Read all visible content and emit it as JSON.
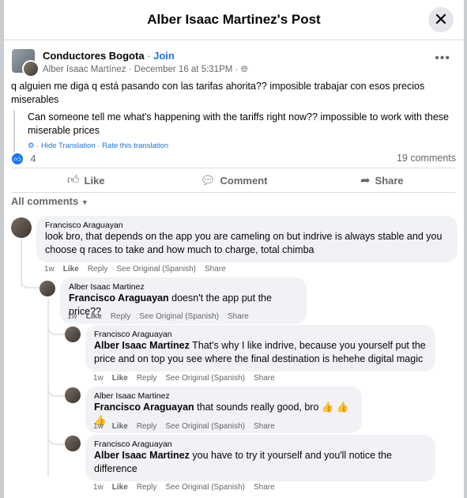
{
  "header": {
    "title": "Alber Isaac Martinez's Post"
  },
  "post": {
    "group": "Conductores Bogota",
    "join": "Join",
    "author_line": "Alber Isaac Martínez · December 16 at 5:31PM ·",
    "text": "q alguien me diga q está pasando con las tarifas ahorita?? imposible trabajar con esos precios miserables",
    "translation": "Can someone tell me what's happening with the tariffs right now?? impossible to work with these miserable prices",
    "hide_translation": "Hide Translation",
    "rate_translation": "Rate this translation",
    "likes": "4",
    "comments_count": "19 comments"
  },
  "actions": {
    "like": "Like",
    "comment": "Comment",
    "share": "Share"
  },
  "filter": {
    "label": "All comments"
  },
  "comments": [
    {
      "author": "Francisco Araguayan",
      "mention": "",
      "text": "look bro, that depends on the app you are cameling on but indrive is always stable and you choose q races to take and how much to charge, total chimba",
      "time": "1w"
    },
    {
      "author": "Alber Isaac Martinez",
      "mention": "Francisco Araguayan",
      "text": " doesn't the app put the price??",
      "time": "1w"
    },
    {
      "author": "Francisco Araguayan",
      "mention": "Alber Isaac Martinez",
      "text": " That's why I like indrive, because you yourself put the price and on top you see where the final destination is hehehe digital magic",
      "time": "1w"
    },
    {
      "author": "Alber Isaac Martinez",
      "mention": "Francisco Araguayan",
      "text": " that sounds really good, bro 👍 👍 👍",
      "time": "1w"
    },
    {
      "author": "Francisco Araguayan",
      "mention": "Alber Isaac Martinez",
      "text": " you have to try it yourself and you'll notice the difference",
      "time": "1w"
    }
  ],
  "comment_actions": {
    "like": "Like",
    "reply": "Reply",
    "see_original": "See Original (Spanish)",
    "share": "Share"
  }
}
